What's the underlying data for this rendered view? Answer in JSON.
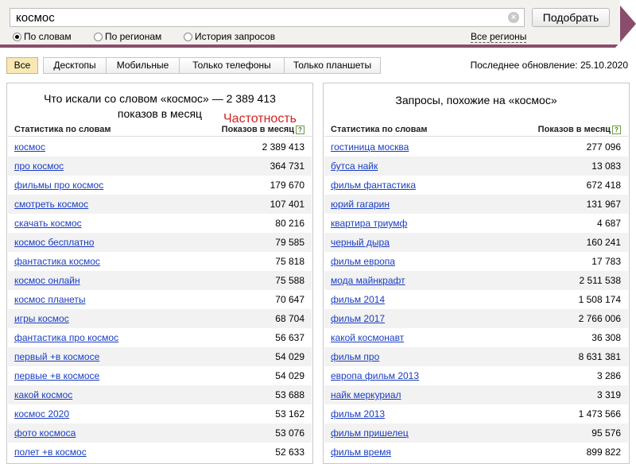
{
  "search": {
    "query": "космос",
    "button_label": "Подобрать"
  },
  "modes": [
    {
      "label": "По словам",
      "selected": true
    },
    {
      "label": "По регионам",
      "selected": false
    },
    {
      "label": "История запросов",
      "selected": false
    }
  ],
  "regions_link": "Все регионы",
  "filter_tabs": [
    {
      "label": "Все",
      "active": true
    },
    {
      "label": "Десктопы",
      "active": false
    },
    {
      "label": "Мобильные",
      "active": false
    },
    {
      "label": "Только телефоны",
      "active": false
    },
    {
      "label": "Только планшеты",
      "active": false
    }
  ],
  "last_update": "Последнее обновление: 25.10.2020",
  "left_panel": {
    "title_line1": "Что искали со словом «космос» — 2 389 413",
    "title_line2": "показов в месяц",
    "annotation": "Частотность",
    "col_keyword": "Статистика по словам",
    "col_count": "Показов в месяц",
    "help_icon": "?",
    "rows": [
      {
        "kw": "космос",
        "count": "2 389 413"
      },
      {
        "kw": "про космос",
        "count": "364 731"
      },
      {
        "kw": "фильмы про космос",
        "count": "179 670"
      },
      {
        "kw": "смотреть космос",
        "count": "107 401"
      },
      {
        "kw": "скачать космос",
        "count": "80 216"
      },
      {
        "kw": "космос бесплатно",
        "count": "79 585"
      },
      {
        "kw": "фантастика космос",
        "count": "75 818"
      },
      {
        "kw": "космос онлайн",
        "count": "75 588"
      },
      {
        "kw": "космос планеты",
        "count": "70 647"
      },
      {
        "kw": "игры космос",
        "count": "68 704"
      },
      {
        "kw": "фантастика про космос",
        "count": "56 637"
      },
      {
        "kw": "первый +в космосе",
        "count": "54 029"
      },
      {
        "kw": "первые +в космосе",
        "count": "54 029"
      },
      {
        "kw": "какой космос",
        "count": "53 688"
      },
      {
        "kw": "космос 2020",
        "count": "53 162"
      },
      {
        "kw": "фото космоса",
        "count": "53 076"
      },
      {
        "kw": "полет +в космос",
        "count": "52 633"
      }
    ]
  },
  "right_panel": {
    "title": "Запросы, похожие на «космос»",
    "col_keyword": "Статистика по словам",
    "col_count": "Показов в месяц",
    "help_icon": "?",
    "rows": [
      {
        "kw": "гостиница москва",
        "count": "277 096"
      },
      {
        "kw": "бутса найк",
        "count": "13 083"
      },
      {
        "kw": "фильм фантастика",
        "count": "672 418"
      },
      {
        "kw": "юрий гагарин",
        "count": "131 967"
      },
      {
        "kw": "квартира триумф",
        "count": "4 687"
      },
      {
        "kw": "черный дыра",
        "count": "160 241"
      },
      {
        "kw": "фильм европа",
        "count": "17 783"
      },
      {
        "kw": "мода майнкрафт",
        "count": "2 511 538"
      },
      {
        "kw": "фильм 2014",
        "count": "1 508 174"
      },
      {
        "kw": "фильм 2017",
        "count": "2 766 006"
      },
      {
        "kw": "какой космонавт",
        "count": "36 308"
      },
      {
        "kw": "фильм про",
        "count": "8 631 381"
      },
      {
        "kw": "европа фильм 2013",
        "count": "3 286"
      },
      {
        "kw": "найк меркуриал",
        "count": "3 319"
      },
      {
        "kw": "фильм 2013",
        "count": "1 473 566"
      },
      {
        "kw": "фильм пришелец",
        "count": "95 576"
      },
      {
        "kw": "фильм время",
        "count": "899 822"
      }
    ]
  }
}
